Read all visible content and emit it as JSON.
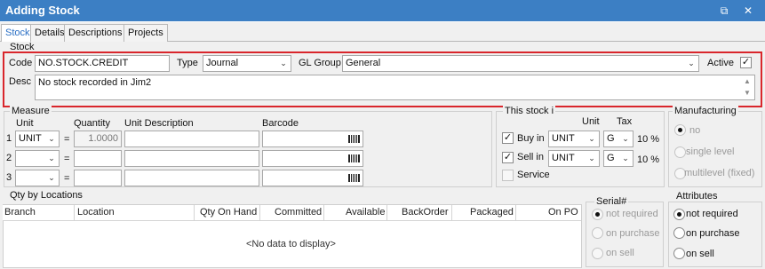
{
  "window": {
    "title": "Adding Stock",
    "restore_icon": "restore-icon",
    "close_icon": "close-icon"
  },
  "tabs": [
    {
      "label": "Stock",
      "active": true
    },
    {
      "label": "Details",
      "active": false
    },
    {
      "label": "Descriptions",
      "active": false
    },
    {
      "label": "Projects",
      "active": false
    }
  ],
  "stock_group": {
    "label": "Stock",
    "code_label": "Code",
    "code_value": "NO.STOCK.CREDIT",
    "type_label": "Type",
    "type_value": "Journal",
    "gl_group_label": "GL Group",
    "gl_group_value": "General",
    "active_label": "Active",
    "active_checked": true,
    "desc_label": "Desc",
    "desc_value": "No stock recorded in Jim2"
  },
  "measure": {
    "label": "Measure",
    "unit_header": "Unit",
    "quantity_header": "Quantity",
    "unit_desc_header": "Unit Description",
    "barcode_header": "Barcode",
    "rows": [
      {
        "num": "1",
        "unit": "UNIT",
        "eq": "=",
        "quantity": "1.0000",
        "unit_desc": "",
        "barcode": ""
      },
      {
        "num": "2",
        "unit": "",
        "eq": "=",
        "quantity": "",
        "unit_desc": "",
        "barcode": ""
      },
      {
        "num": "3",
        "unit": "",
        "eq": "=",
        "quantity": "",
        "unit_desc": "",
        "barcode": ""
      }
    ]
  },
  "this_stock": {
    "label": "This stock i",
    "unit_header": "Unit",
    "tax_header": "Tax",
    "buy_in_label": "Buy in",
    "buy_in_checked": true,
    "buy_unit": "UNIT",
    "buy_tax": "G",
    "buy_tax_pct": "10 %",
    "sell_in_label": "Sell in",
    "sell_in_checked": true,
    "sell_unit": "UNIT",
    "sell_tax": "G",
    "sell_tax_pct": "10 %",
    "service_label": "Service",
    "service_checked": false
  },
  "manufacturing": {
    "label": "Manufacturing",
    "options": [
      {
        "label": "no",
        "checked": true
      },
      {
        "label": "single level",
        "checked": false
      },
      {
        "label": "multilevel (fixed)",
        "checked": false
      }
    ]
  },
  "qty_by_locations": {
    "label": "Qty by Locations",
    "columns": [
      "Branch",
      "Location",
      "Qty On Hand",
      "Committed",
      "Available",
      "BackOrder",
      "Packaged",
      "On PO"
    ],
    "empty_text": "<No data to display>"
  },
  "serial": {
    "label": "Serial#",
    "options": [
      {
        "label": "not required",
        "checked": true
      },
      {
        "label": "on purchase",
        "checked": false
      },
      {
        "label": "on sell",
        "checked": false
      }
    ]
  },
  "attributes": {
    "label": "Attributes",
    "options": [
      {
        "label": "not required",
        "checked": true
      },
      {
        "label": "on purchase",
        "checked": false
      },
      {
        "label": "on sell",
        "checked": false
      }
    ]
  },
  "colors": {
    "titlebar": "#3c7fc4",
    "highlight_border": "#d9262c",
    "active_tab_text": "#2a6fc4"
  }
}
